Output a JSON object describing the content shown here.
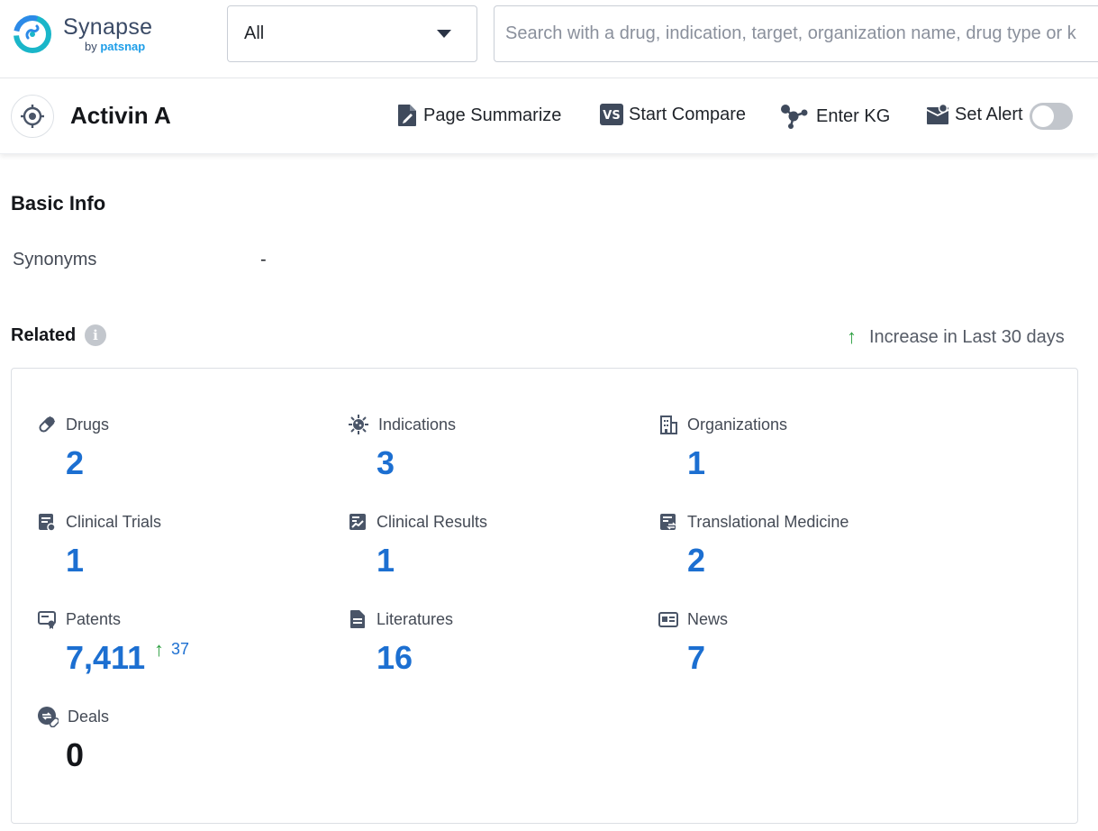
{
  "brand": {
    "name": "Synapse",
    "by": "by",
    "sub": "patsnap"
  },
  "search": {
    "scope_value": "All",
    "placeholder": "Search with a drug, indication, target, organization name, drug type or k"
  },
  "entity": {
    "title": "Activin A",
    "actions": {
      "summarize": "Page Summarize",
      "compare": "Start Compare",
      "kg": "Enter KG",
      "alert": "Set Alert"
    },
    "alert_enabled": false
  },
  "basic_info": {
    "title": "Basic Info",
    "synonyms_label": "Synonyms",
    "synonyms_value": "-"
  },
  "related": {
    "title": "Related",
    "increase_legend": "Increase in Last 30 days",
    "stats": [
      {
        "key": "drugs",
        "label": "Drugs",
        "value": "2",
        "icon": "pill-icon"
      },
      {
        "key": "indications",
        "label": "Indications",
        "value": "3",
        "icon": "virus-icon"
      },
      {
        "key": "organizations",
        "label": "Organizations",
        "value": "1",
        "icon": "building-icon"
      },
      {
        "key": "clinical_trials",
        "label": "Clinical Trials",
        "value": "1",
        "icon": "clipboard-icon"
      },
      {
        "key": "clinical_results",
        "label": "Clinical Results",
        "value": "1",
        "icon": "chart-report-icon"
      },
      {
        "key": "translational_medicine",
        "label": "Translational Medicine",
        "value": "2",
        "icon": "exchange-doc-icon"
      },
      {
        "key": "patents",
        "label": "Patents",
        "value": "7,411",
        "delta": "37",
        "icon": "certificate-icon"
      },
      {
        "key": "literatures",
        "label": "Literatures",
        "value": "16",
        "icon": "document-icon"
      },
      {
        "key": "news",
        "label": "News",
        "value": "7",
        "icon": "newspaper-icon"
      },
      {
        "key": "deals",
        "label": "Deals",
        "value": "0",
        "icon": "handshake-icon"
      }
    ]
  },
  "colors": {
    "accent_blue": "#1c6fd1",
    "increase_green": "#2ea042",
    "icon_slate": "#4a5568"
  }
}
